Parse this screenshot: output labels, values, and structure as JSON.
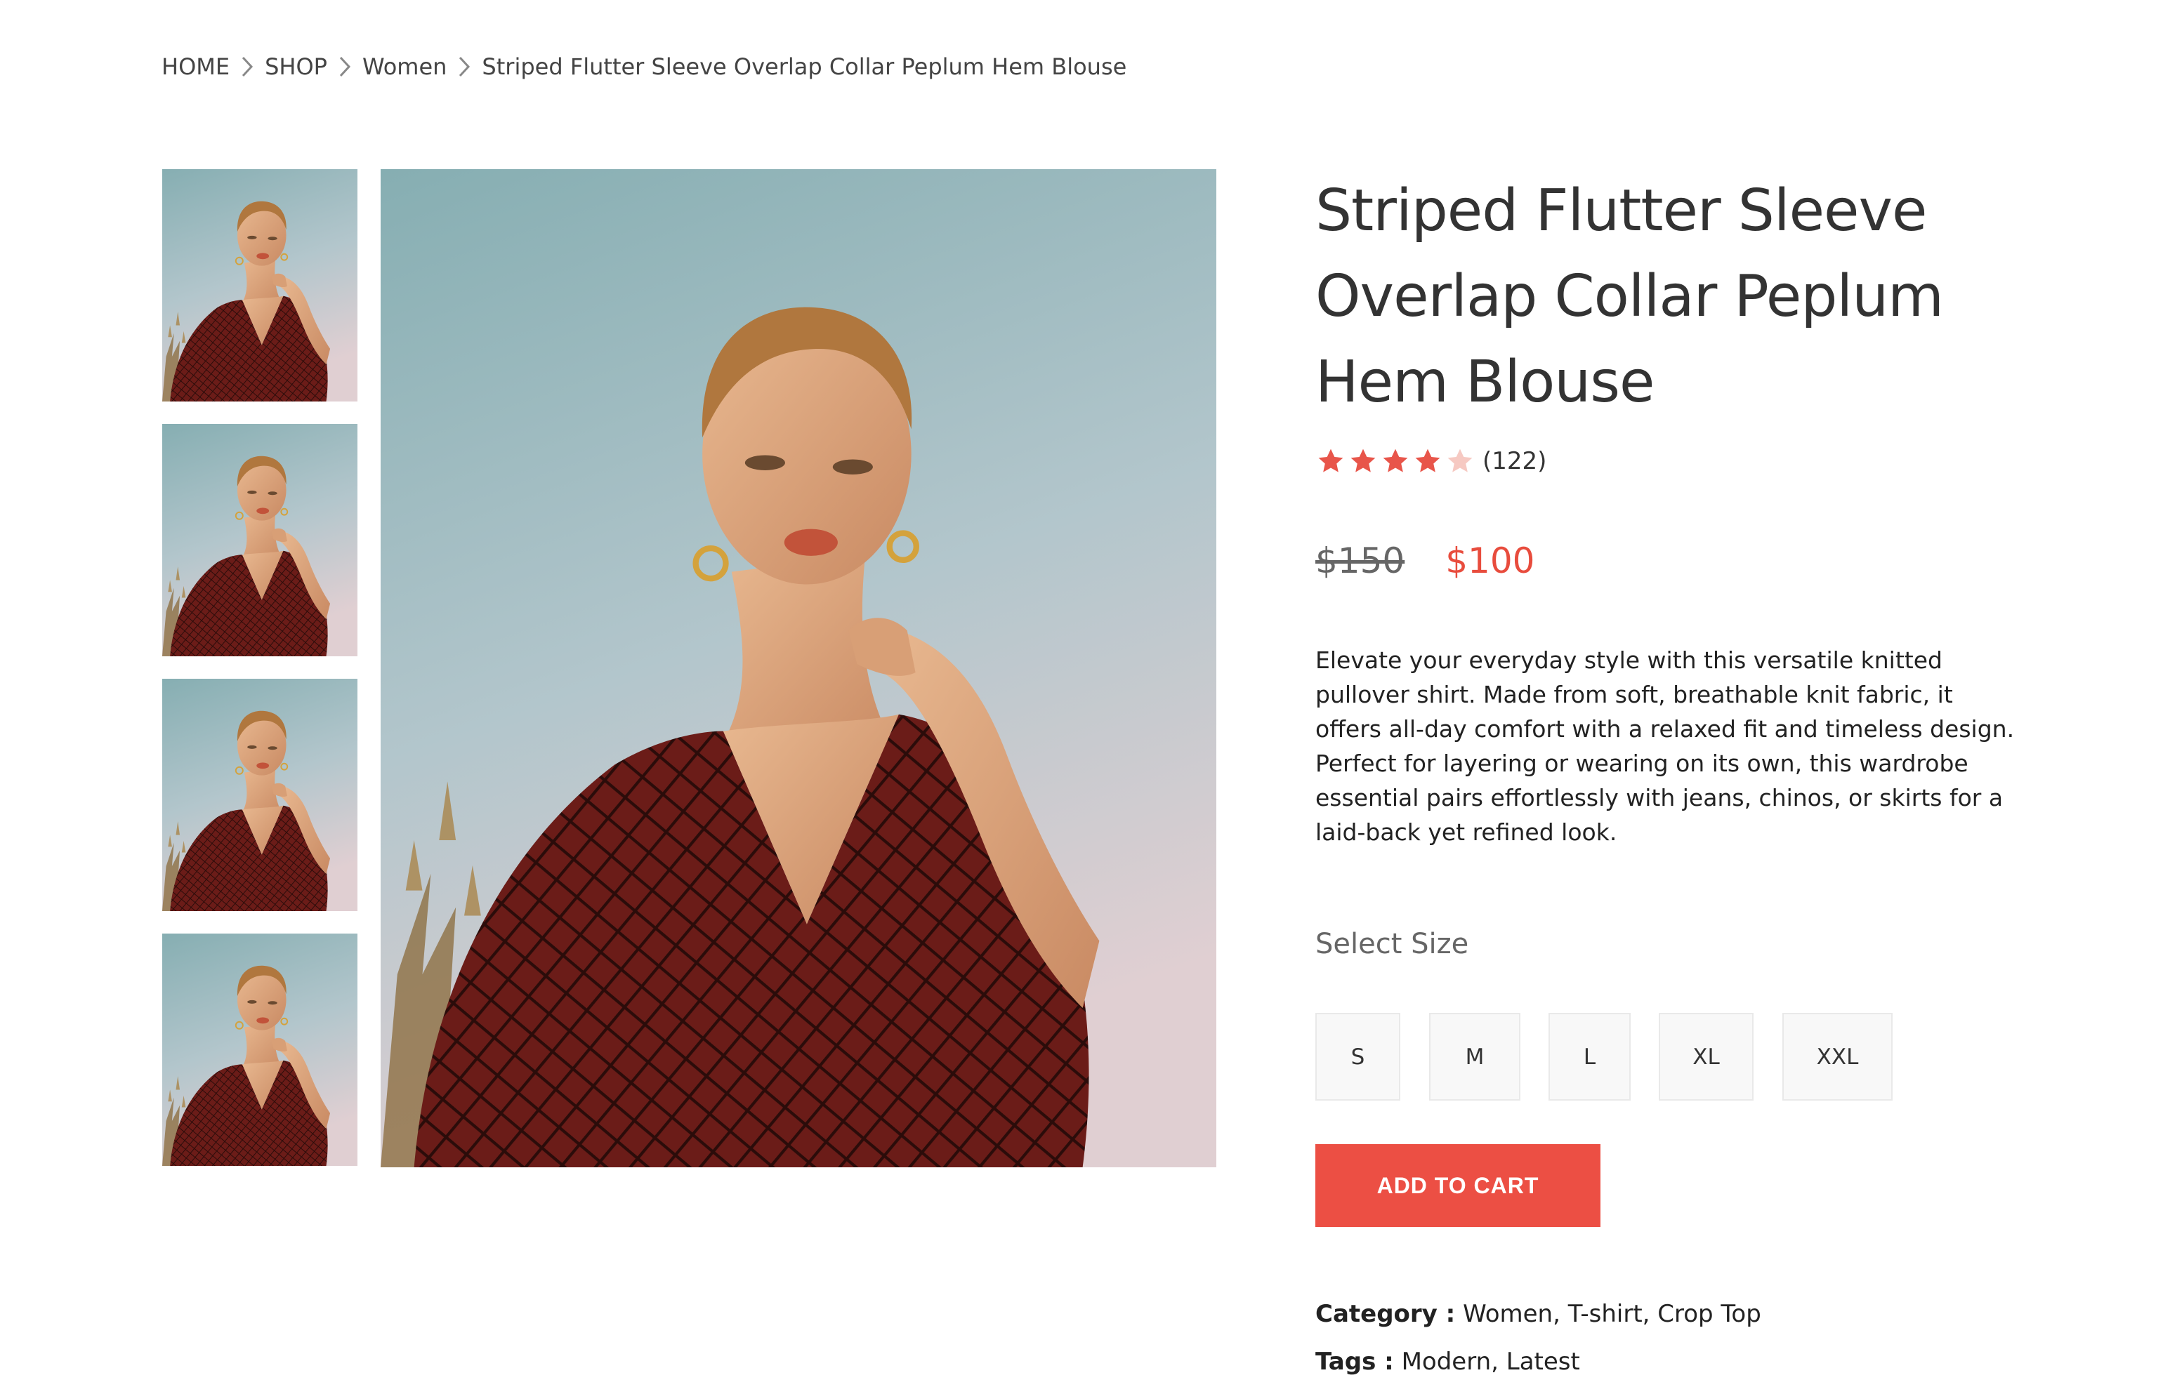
{
  "breadcrumb": {
    "items": [
      "HOME",
      "SHOP",
      "Women"
    ],
    "current": "Striped Flutter Sleeve Overlap Collar Peplum Hem Blouse"
  },
  "product": {
    "title": "Striped Flutter Sleeve Overlap Collar Peplum Hem Blouse",
    "rating": 4,
    "rating_max": 5,
    "review_count": "(122)",
    "old_price": "$150",
    "new_price": "$100",
    "description": "Elevate your everyday style with this versatile knitted pullover shirt. Made from soft, breathable knit fabric, it offers all-day comfort with a relaxed fit and timeless design. Perfect for layering or wearing on its own, this wardrobe essential pairs effortlessly with jeans, chinos, or skirts for a laid-back yet refined look.",
    "select_size_label": "Select Size",
    "sizes": [
      "S",
      "M",
      "L",
      "XL",
      "XXL"
    ],
    "add_to_cart_label": "ADD TO CART",
    "category_label": "Category :",
    "category_value": "Women, T-shirt, Crop Top",
    "tags_label": "Tags :",
    "tags_value": "Modern, Latest"
  },
  "gallery": {
    "thumbnail_count": 4,
    "image_subject": "model-in-red-checked-blouse"
  },
  "colors": {
    "accent": "#ec4f44",
    "price_red": "#e84c3d",
    "star_filled": "#e8554a",
    "star_empty": "#f6c9c2",
    "sky_top": "#8db2b6",
    "blouse": "#6e1e1a"
  }
}
